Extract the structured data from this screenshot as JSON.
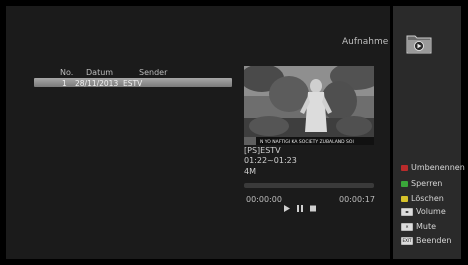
{
  "screen": {
    "title": "Aufnahme",
    "list": {
      "columns": [
        "No.",
        "Datum",
        "Sender"
      ],
      "rows": [
        {
          "no": "1",
          "datum": "28/11/2013",
          "sender": "ESTV"
        }
      ]
    },
    "preview": {
      "ticker_text": "N YO NAFTIGI KA SOCIETY ZUBALAND SOI"
    },
    "info": {
      "channel": "[PS]ESTV",
      "time_range": "01:22~01:23",
      "size": "4M"
    },
    "player": {
      "elapsed": "00:00:00",
      "total": "00:00:17",
      "progress": 0
    },
    "legend": [
      {
        "label": "Umbenennen",
        "icon": "red-button-icon",
        "color": "#b92b2b"
      },
      {
        "label": "Sperren",
        "icon": "green-button-icon",
        "color": "#3aa63a"
      },
      {
        "label": "Löschen",
        "icon": "yellow-button-icon",
        "color": "#d6c22a"
      },
      {
        "label": "Volume",
        "icon": "volume-key-icon",
        "color": "#dddddd"
      },
      {
        "label": "Mute",
        "icon": "mute-key-icon",
        "color": "#dddddd"
      },
      {
        "label": "Beenden",
        "icon": "exit-key-icon",
        "color": "#dddddd"
      }
    ]
  }
}
